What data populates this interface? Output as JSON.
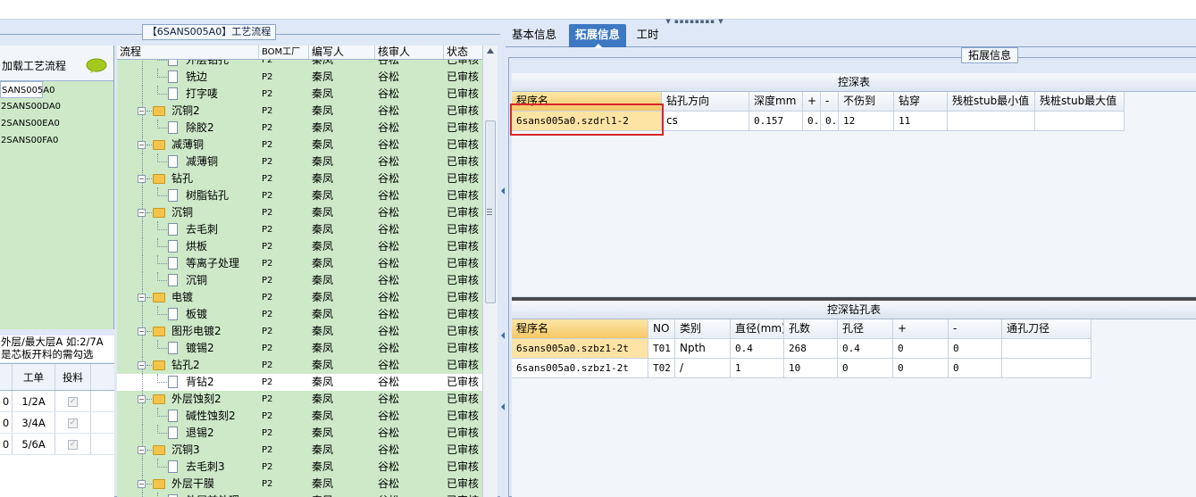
{
  "app": {
    "flow_title": "【6SANS005A0】工艺流程"
  },
  "product_list": {
    "load_label": "加载工艺流程",
    "items": [
      "SANS005A0",
      "2SANS00DA0",
      "2SANS00EA0",
      "2SANS00FA0"
    ],
    "hint_line1": "外层/最大层A 如:2/7A",
    "hint_line2": "是芯板开料的需勾选",
    "table_headers": [
      "",
      "工单",
      "投料"
    ],
    "table_rows": [
      {
        "c1": "0",
        "order": "1/2A",
        "checked": "✓"
      },
      {
        "c1": "0",
        "order": "3/4A",
        "checked": "✓"
      },
      {
        "c1": "0",
        "order": "5/6A",
        "checked": "✓"
      }
    ]
  },
  "tree": {
    "headers": [
      "流程",
      "BOM工厂",
      "编写人",
      "核审人",
      "状态"
    ],
    "rows": [
      {
        "label": "外层钻孔",
        "level": 1,
        "type": "doc",
        "bom": "P2",
        "writer": "秦凤",
        "reviewer": "谷松",
        "status": "已审核"
      },
      {
        "label": "铣边",
        "level": 1,
        "type": "doc",
        "bom": "P2",
        "writer": "秦凤",
        "reviewer": "谷松",
        "status": "已审核"
      },
      {
        "label": "打字唛",
        "level": 1,
        "type": "doc",
        "bom": "P2",
        "writer": "秦凤",
        "reviewer": "谷松",
        "status": "已审核"
      },
      {
        "label": "沉铜2",
        "level": 0,
        "type": "folder",
        "bom": "P2",
        "writer": "秦凤",
        "reviewer": "谷松",
        "status": "已审核"
      },
      {
        "label": "除胶2",
        "level": 1,
        "type": "doc",
        "bom": "P2",
        "writer": "秦凤",
        "reviewer": "谷松",
        "status": "已审核"
      },
      {
        "label": "减薄铜",
        "level": 0,
        "type": "folder",
        "bom": "P2",
        "writer": "秦凤",
        "reviewer": "谷松",
        "status": "已审核"
      },
      {
        "label": "减薄铜",
        "level": 1,
        "type": "doc",
        "bom": "P2",
        "writer": "秦凤",
        "reviewer": "谷松",
        "status": "已审核"
      },
      {
        "label": "钻孔",
        "level": 0,
        "type": "folder",
        "bom": "P2",
        "writer": "秦凤",
        "reviewer": "谷松",
        "status": "已审核"
      },
      {
        "label": "树脂钻孔",
        "level": 1,
        "type": "doc",
        "bom": "P2",
        "writer": "秦凤",
        "reviewer": "谷松",
        "status": "已审核"
      },
      {
        "label": "沉铜",
        "level": 0,
        "type": "folder",
        "bom": "P2",
        "writer": "秦凤",
        "reviewer": "谷松",
        "status": "已审核"
      },
      {
        "label": "去毛刺",
        "level": 1,
        "type": "doc",
        "bom": "P2",
        "writer": "秦凤",
        "reviewer": "谷松",
        "status": "已审核"
      },
      {
        "label": "烘板",
        "level": 1,
        "type": "doc",
        "bom": "P2",
        "writer": "秦凤",
        "reviewer": "谷松",
        "status": "已审核"
      },
      {
        "label": "等离子处理",
        "level": 1,
        "type": "doc",
        "bom": "P2",
        "writer": "秦凤",
        "reviewer": "谷松",
        "status": "已审核"
      },
      {
        "label": "沉铜",
        "level": 1,
        "type": "doc",
        "bom": "P2",
        "writer": "秦凤",
        "reviewer": "谷松",
        "status": "已审核"
      },
      {
        "label": "电镀",
        "level": 0,
        "type": "folder",
        "bom": "P2",
        "writer": "秦凤",
        "reviewer": "谷松",
        "status": "已审核"
      },
      {
        "label": "板镀",
        "level": 1,
        "type": "doc",
        "bom": "P2",
        "writer": "秦凤",
        "reviewer": "谷松",
        "status": "已审核"
      },
      {
        "label": "图形电镀2",
        "level": 0,
        "type": "folder",
        "bom": "P2",
        "writer": "秦凤",
        "reviewer": "谷松",
        "status": "已审核"
      },
      {
        "label": "镀锡2",
        "level": 1,
        "type": "doc",
        "bom": "P2",
        "writer": "秦凤",
        "reviewer": "谷松",
        "status": "已审核"
      },
      {
        "label": "钻孔2",
        "level": 0,
        "type": "folder",
        "bom": "P2",
        "writer": "秦凤",
        "reviewer": "谷松",
        "status": "已审核"
      },
      {
        "label": "背钻2",
        "level": 1,
        "type": "doc",
        "bom": "P2",
        "writer": "秦凤",
        "reviewer": "谷松",
        "status": "已审核",
        "highlight": true
      },
      {
        "label": "外层蚀刻2",
        "level": 0,
        "type": "folder",
        "bom": "P2",
        "writer": "秦凤",
        "reviewer": "谷松",
        "status": "已审核"
      },
      {
        "label": "碱性蚀刻2",
        "level": 1,
        "type": "doc",
        "bom": "P2",
        "writer": "秦凤",
        "reviewer": "谷松",
        "status": "已审核"
      },
      {
        "label": "退锡2",
        "level": 1,
        "type": "doc",
        "bom": "P2",
        "writer": "秦凤",
        "reviewer": "谷松",
        "status": "已审核"
      },
      {
        "label": "沉铜3",
        "level": 0,
        "type": "folder",
        "bom": "P2",
        "writer": "秦凤",
        "reviewer": "谷松",
        "status": "已审核"
      },
      {
        "label": "去毛刺3",
        "level": 1,
        "type": "doc",
        "bom": "P2",
        "writer": "秦凤",
        "reviewer": "谷松",
        "status": "已审核"
      },
      {
        "label": "外层干膜",
        "level": 0,
        "type": "folder",
        "bom": "P2",
        "writer": "秦凤",
        "reviewer": "谷松",
        "status": "已审核"
      },
      {
        "label": "外层前处理",
        "level": 1,
        "type": "doc",
        "bom": "P2",
        "writer": "秦凤",
        "reviewer": "谷松",
        "status": "已审核"
      }
    ]
  },
  "tabs": [
    "基本信息",
    "拓展信息",
    "工时"
  ],
  "ext_group_title": "拓展信息",
  "depth_table": {
    "title": "控深表",
    "headers": [
      "程序名",
      "钻孔方向",
      "深度mm",
      "+",
      "-",
      "不伤到",
      "钻穿",
      "残桩stub最小值",
      "残桩stub最大值"
    ],
    "rows": [
      [
        "6sans005a0.szdrl1-2",
        "cs",
        "0.157",
        "0..",
        "0..",
        "12",
        "11",
        "",
        ""
      ]
    ]
  },
  "hole_table": {
    "title": "控深钻孔表",
    "headers": [
      "程序名",
      "NO",
      "类别",
      "直径(mm)",
      "孔数",
      "孔径",
      "+",
      "-",
      "通孔刀径"
    ],
    "rows": [
      [
        "6sans005a0.szbz1-2t",
        "T01",
        "Npth",
        "0.4",
        "268",
        "0.4",
        "0",
        "0",
        ""
      ],
      [
        "6sans005a0.szbz1-2t",
        "T02",
        "/",
        "1",
        "10",
        "0",
        "0",
        "0",
        ""
      ]
    ]
  },
  "colors": {
    "tree_bg": "#cde9c8",
    "tab_active": "#3d78c3",
    "selected_cell": "#fde3a4",
    "annotation_box": "#d9262b"
  }
}
